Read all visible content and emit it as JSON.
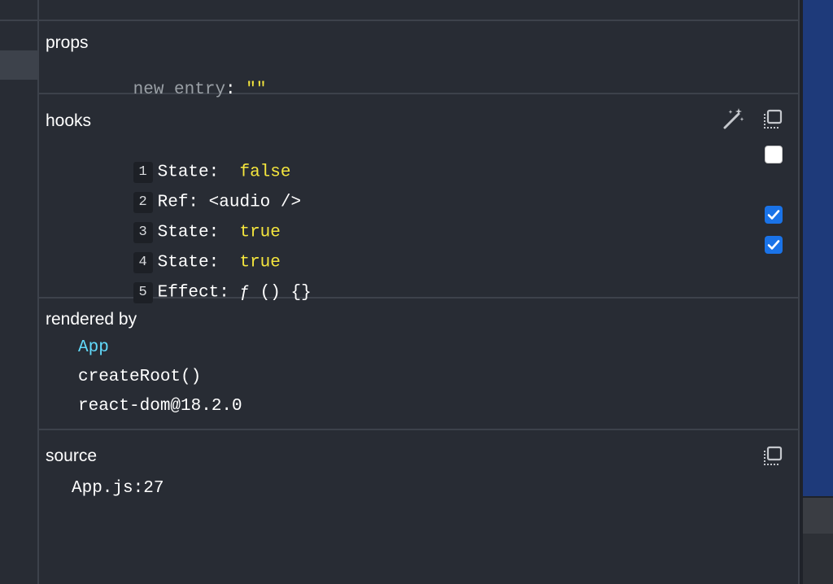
{
  "props": {
    "title": "props",
    "entry_key": "new entry",
    "entry_colon": ":",
    "entry_value": "\"\""
  },
  "hooks": {
    "title": "hooks",
    "items": [
      {
        "index": "1",
        "name": "State:",
        "value": "false",
        "value_style": "yellow",
        "checkbox": "unchecked"
      },
      {
        "index": "2",
        "name": "Ref:",
        "value": "<audio />",
        "value_style": "white",
        "checkbox": null
      },
      {
        "index": "3",
        "name": "State:",
        "value": "true",
        "value_style": "yellow",
        "checkbox": "checked"
      },
      {
        "index": "4",
        "name": "State:",
        "value": "true",
        "value_style": "yellow",
        "checkbox": "checked"
      },
      {
        "index": "5",
        "name": "Effect:",
        "value": "ƒ () {}",
        "value_style": "white",
        "checkbox": null
      }
    ],
    "icons": [
      "magic-wand-icon",
      "copy-icon"
    ]
  },
  "rendered_by": {
    "title": "rendered by",
    "items": [
      "App",
      "createRoot()",
      "react-dom@18.2.0"
    ]
  },
  "source": {
    "title": "source",
    "location": "App.js:27",
    "icons": [
      "copy-icon"
    ]
  },
  "colors": {
    "background": "#282c34",
    "divider": "#3d424b",
    "value_yellow": "#f5e63d",
    "component_cyan": "#61dafb",
    "checkbox_blue": "#1a73e8"
  }
}
